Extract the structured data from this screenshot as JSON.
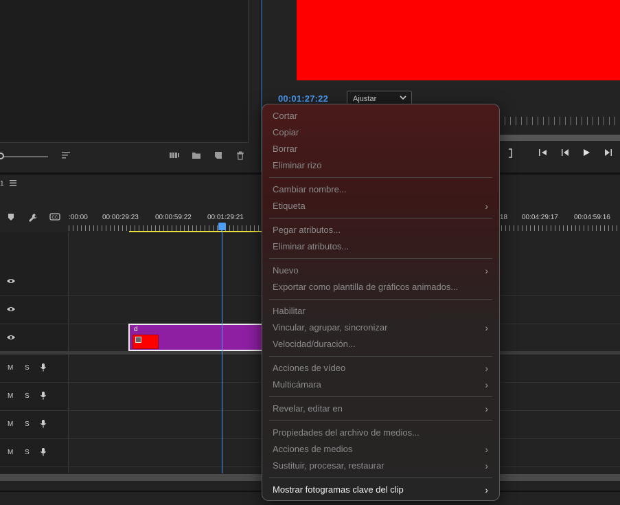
{
  "program_monitor": {
    "timecode": "00:01:27:22",
    "fit_value": "Ajustar",
    "frame_color": "#ff0000"
  },
  "timeline": {
    "sequence_label": "1",
    "ruler_labels": [
      ":00:00",
      "00:00:29:23",
      "00:00:59:22",
      "00:01:29:21",
      "18",
      "00:04:29:17",
      "00:04:59:16"
    ],
    "audio_tracks": [
      {
        "m": "M",
        "s": "S"
      },
      {
        "m": "M",
        "s": "S"
      },
      {
        "m": "M",
        "s": "S"
      },
      {
        "m": "M",
        "s": "S"
      }
    ],
    "clip": {
      "name": "d",
      "color": "#8e1fa3"
    }
  },
  "context_menu": {
    "groups": [
      [
        {
          "label": "Cortar",
          "enabled": false,
          "submenu": false
        },
        {
          "label": "Copiar",
          "enabled": false,
          "submenu": false
        },
        {
          "label": "Borrar",
          "enabled": false,
          "submenu": false
        },
        {
          "label": "Eliminar rizo",
          "enabled": false,
          "submenu": false
        }
      ],
      [
        {
          "label": "Cambiar nombre...",
          "enabled": false,
          "submenu": false
        },
        {
          "label": "Etiqueta",
          "enabled": false,
          "submenu": true
        }
      ],
      [
        {
          "label": "Pegar atributos...",
          "enabled": false,
          "submenu": false
        },
        {
          "label": "Eliminar atributos...",
          "enabled": false,
          "submenu": false
        }
      ],
      [
        {
          "label": "Nuevo",
          "enabled": false,
          "submenu": true
        },
        {
          "label": "Exportar como plantilla de gráficos animados...",
          "enabled": false,
          "submenu": false
        }
      ],
      [
        {
          "label": "Habilitar",
          "enabled": false,
          "submenu": false
        },
        {
          "label": "Vincular, agrupar, sincronizar",
          "enabled": false,
          "submenu": true
        },
        {
          "label": "Velocidad/duración...",
          "enabled": false,
          "submenu": false
        }
      ],
      [
        {
          "label": "Acciones de vídeo",
          "enabled": false,
          "submenu": true
        },
        {
          "label": "Multicámara",
          "enabled": false,
          "submenu": true
        }
      ],
      [
        {
          "label": "Revelar, editar en",
          "enabled": false,
          "submenu": true
        }
      ],
      [
        {
          "label": "Propiedades del archivo de medios...",
          "enabled": false,
          "submenu": false
        },
        {
          "label": "Acciones de medios",
          "enabled": false,
          "submenu": true
        },
        {
          "label": "Sustituir, procesar, restaurar",
          "enabled": false,
          "submenu": true
        }
      ],
      [
        {
          "label": "Mostrar fotogramas clave del clip",
          "enabled": true,
          "submenu": true
        }
      ]
    ]
  }
}
